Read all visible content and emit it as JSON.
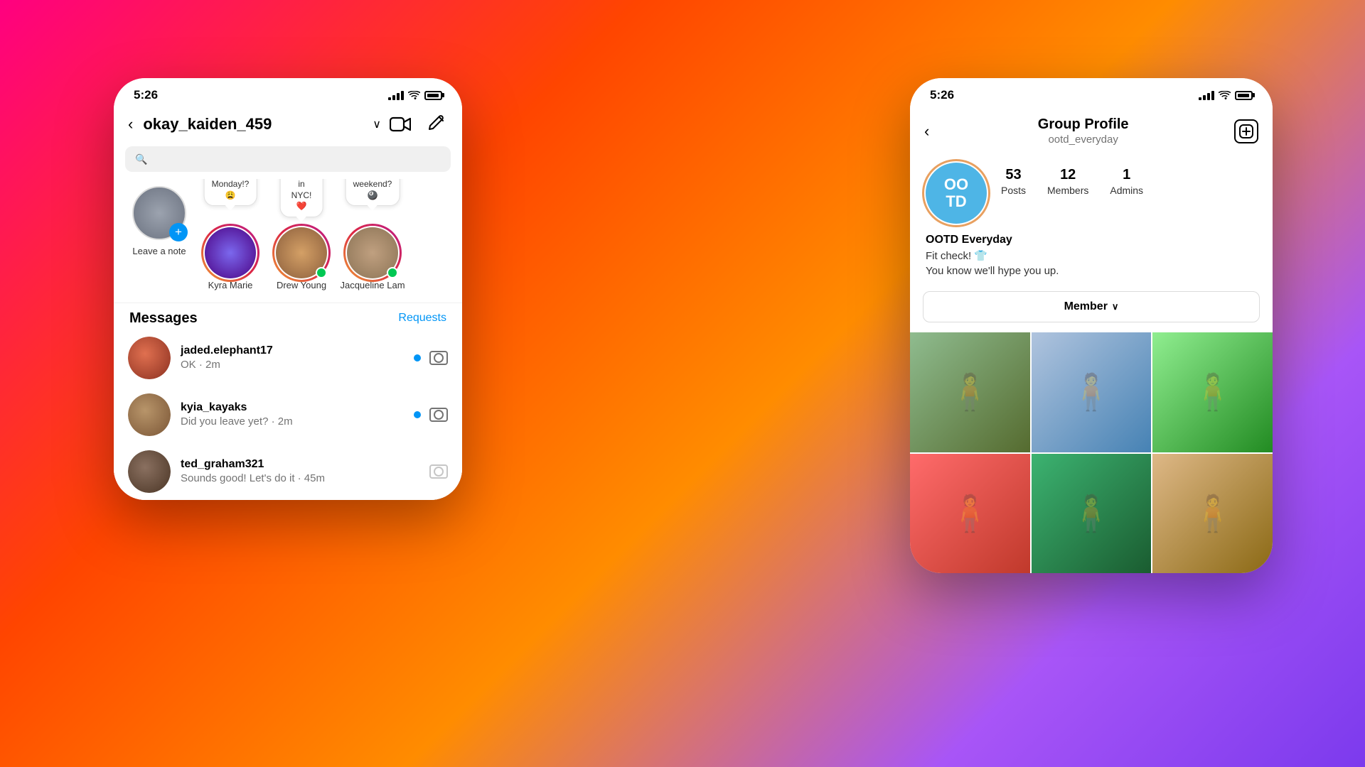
{
  "background": {
    "gradient": "linear-gradient(135deg, #ff0080 0%, #ff4500 30%, #ff8c00 55%, #a855f7 80%, #7c3aed 100%)"
  },
  "left_phone": {
    "status_bar": {
      "time": "5:26"
    },
    "header": {
      "username": "okay_kaiden_459",
      "back_label": "<",
      "chevron": "∨"
    },
    "stories": [
      {
        "id": "leave-note",
        "name": "Leave a note",
        "has_add": true,
        "note": null
      },
      {
        "id": "kyra",
        "name": "Kyra Marie",
        "note": "Why is tomorrow Monday!? 😩",
        "online": false
      },
      {
        "id": "drew",
        "name": "Drew Young",
        "note": "Finally landing in NYC! ❤️",
        "online": true
      },
      {
        "id": "jacq",
        "name": "Jacqueline Lam",
        "note": "Game night this weekend? 🎱",
        "online": true
      }
    ],
    "messages_section": {
      "title": "Messages",
      "requests_label": "Requests",
      "items": [
        {
          "id": "jaded",
          "username": "jaded.elephant17",
          "preview": "OK · 2m",
          "unread": true
        },
        {
          "id": "kyia",
          "username": "kyia_kayaks",
          "preview": "Did you leave yet? · 2m",
          "unread": true
        },
        {
          "id": "ted",
          "username": "ted_graham321",
          "preview": "Sounds good! Let's do it · 45m",
          "unread": false
        }
      ]
    }
  },
  "right_phone": {
    "status_bar": {
      "time": "5:26"
    },
    "header": {
      "title": "Group Profile",
      "subtitle": "ootd_everyday"
    },
    "group": {
      "avatar_text": "OO\nTD",
      "stats": [
        {
          "number": "53",
          "label": "Posts"
        },
        {
          "number": "12",
          "label": "Members"
        },
        {
          "number": "1",
          "label": "Admins"
        }
      ],
      "name": "OOTD Everyday",
      "description": "Fit check! 👕\nYou know we'll hype you up.",
      "member_button": "Member",
      "photos": [
        {
          "id": "photo-1",
          "color_class": "photo-1"
        },
        {
          "id": "photo-2",
          "color_class": "photo-2"
        },
        {
          "id": "photo-3",
          "color_class": "photo-3"
        },
        {
          "id": "photo-4",
          "color_class": "photo-4"
        },
        {
          "id": "photo-5",
          "color_class": "photo-5"
        },
        {
          "id": "photo-6",
          "color_class": "photo-6"
        }
      ]
    }
  }
}
